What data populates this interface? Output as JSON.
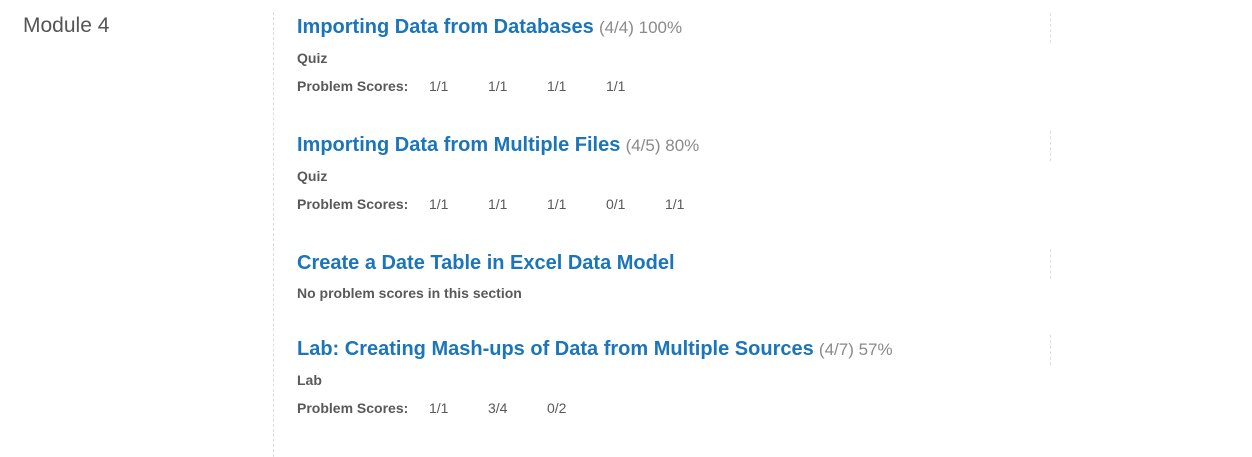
{
  "module": {
    "title": "Module 4"
  },
  "colors": {
    "link": "#1b75bb",
    "summary": "#8a8a8a",
    "text": "#595959"
  },
  "sections": [
    {
      "title": "Importing Data from Databases",
      "summary": "(4/4) 100%",
      "type": "Quiz",
      "scores_label": "Problem Scores:",
      "scores": [
        "1/1",
        "1/1",
        "1/1",
        "1/1"
      ]
    },
    {
      "title": "Importing Data from Multiple Files",
      "summary": "(4/5) 80%",
      "type": "Quiz",
      "scores_label": "Problem Scores:",
      "scores": [
        "1/1",
        "1/1",
        "1/1",
        "0/1",
        "1/1"
      ]
    },
    {
      "title": "Create a Date Table in Excel Data Model",
      "summary": "",
      "no_scores_text": "No problem scores in this section"
    },
    {
      "title": "Lab: Creating Mash-ups of Data from Multiple Sources",
      "summary": "(4/7) 57%",
      "type": "Lab",
      "scores_label": "Problem Scores:",
      "scores": [
        "1/1",
        "3/4",
        "0/2"
      ]
    }
  ]
}
